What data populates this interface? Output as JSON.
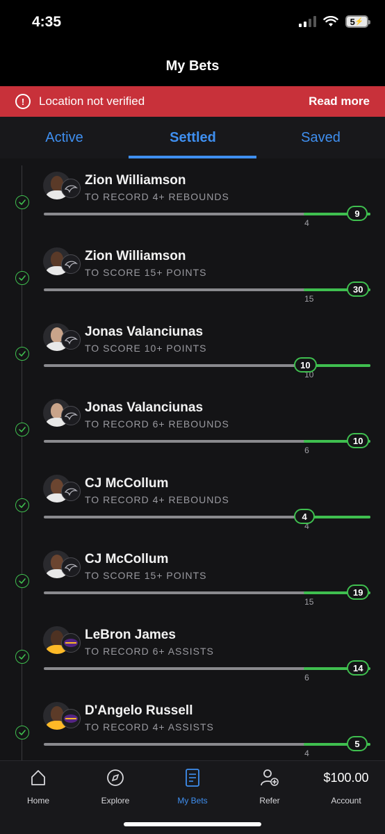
{
  "status": {
    "time": "4:35",
    "battery": "5"
  },
  "header": {
    "title": "My Bets"
  },
  "alert": {
    "text": "Location not verified",
    "link": "Read more",
    "icon": "exclamation-circle-icon"
  },
  "tabs": [
    {
      "label": "Active",
      "active": false
    },
    {
      "label": "Settled",
      "active": true
    },
    {
      "label": "Saved",
      "active": false
    }
  ],
  "bets": [
    {
      "player": "Zion Williamson",
      "market": "TO RECORD 4+ REBOUNDS",
      "line": "4",
      "result": "9",
      "line_value": 4,
      "result_value": 9,
      "team": "pelicans",
      "skin": "#5a3a28"
    },
    {
      "player": "Zion Williamson",
      "market": "TO SCORE 15+ POINTS",
      "line": "15",
      "result": "30",
      "line_value": 15,
      "result_value": 30,
      "team": "pelicans",
      "skin": "#5a3a28"
    },
    {
      "player": "Jonas Valanciunas",
      "market": "TO SCORE 10+ POINTS",
      "line": "10",
      "result": "10",
      "line_value": 10,
      "result_value": 10,
      "team": "pelicans",
      "skin": "#c9a48a"
    },
    {
      "player": "Jonas Valanciunas",
      "market": "TO RECORD 6+ REBOUNDS",
      "line": "6",
      "result": "10",
      "line_value": 6,
      "result_value": 10,
      "team": "pelicans",
      "skin": "#c9a48a"
    },
    {
      "player": "CJ McCollum",
      "market": "TO RECORD 4+ REBOUNDS",
      "line": "4",
      "result": "4",
      "line_value": 4,
      "result_value": 4,
      "team": "pelicans",
      "skin": "#6b4530"
    },
    {
      "player": "CJ McCollum",
      "market": "TO SCORE 15+ POINTS",
      "line": "15",
      "result": "19",
      "line_value": 15,
      "result_value": 19,
      "team": "pelicans",
      "skin": "#6b4530"
    },
    {
      "player": "LeBron James",
      "market": "TO RECORD 6+ ASSISTS",
      "line": "6",
      "result": "14",
      "line_value": 6,
      "result_value": 14,
      "team": "lakers",
      "skin": "#4e3222"
    },
    {
      "player": "D'Angelo Russell",
      "market": "TO RECORD 4+ ASSISTS",
      "line": "4",
      "result": "5",
      "line_value": 4,
      "result_value": 5,
      "team": "lakers",
      "skin": "#5c3b28"
    }
  ],
  "bottom_nav": [
    {
      "label": "Home",
      "icon": "home-icon",
      "active": false
    },
    {
      "label": "Explore",
      "icon": "compass-icon",
      "active": false
    },
    {
      "label": "My Bets",
      "icon": "betslip-icon",
      "active": true
    },
    {
      "label": "Refer",
      "icon": "add-user-icon",
      "active": false
    },
    {
      "label": "Account",
      "value": "$100.00",
      "active": false
    }
  ],
  "colors": {
    "accent": "#3f8ff0",
    "success": "#3fbf4f",
    "alert": "#c8313a",
    "lakers": "#fdb927"
  }
}
